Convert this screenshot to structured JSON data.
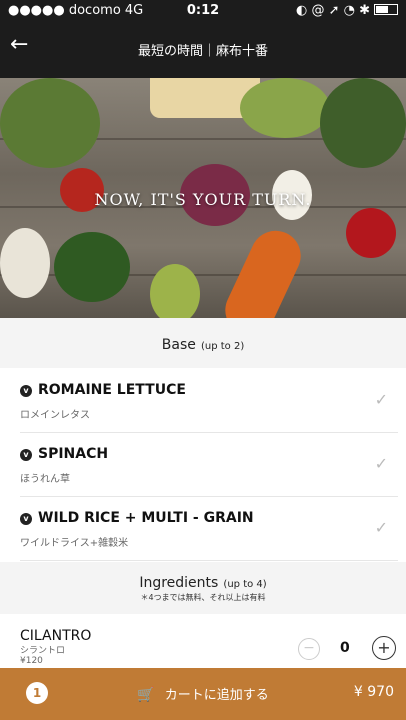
{
  "status_bar": {
    "carrier": "●●●●● docomo  4G",
    "time": "0:12",
    "indicators": "◐ @ ➚ ◔ ✱"
  },
  "nav": {
    "title": "最短の時間｜麻布十番"
  },
  "hero": {
    "text": "NOW, IT'S YOUR TURN."
  },
  "base": {
    "header": "Base",
    "limit": "(up to 2)",
    "items": [
      {
        "title": "ROMAINE LETTUCE",
        "subtitle": "ロメインレタス"
      },
      {
        "title": "SPINACH",
        "subtitle": "ほうれん草"
      },
      {
        "title": "WILD RICE + MULTI - GRAIN",
        "subtitle": "ワイルドライス+雑穀米"
      }
    ]
  },
  "ingredients": {
    "header": "Ingredients",
    "limit": "(up to 4)",
    "note": "＊4つまでは無料、それ以上は有料",
    "items": [
      {
        "title": "CILANTRO",
        "subtitle": "シラントロ",
        "price": "¥120",
        "quantity": "0"
      }
    ]
  },
  "cart": {
    "count": "1",
    "label": "カートに追加する",
    "total": "¥ 970"
  },
  "colors": {
    "nav_bg": "#1c1c1c",
    "cart_bar": "#c07b35",
    "section_bg": "#f4f4f4"
  }
}
